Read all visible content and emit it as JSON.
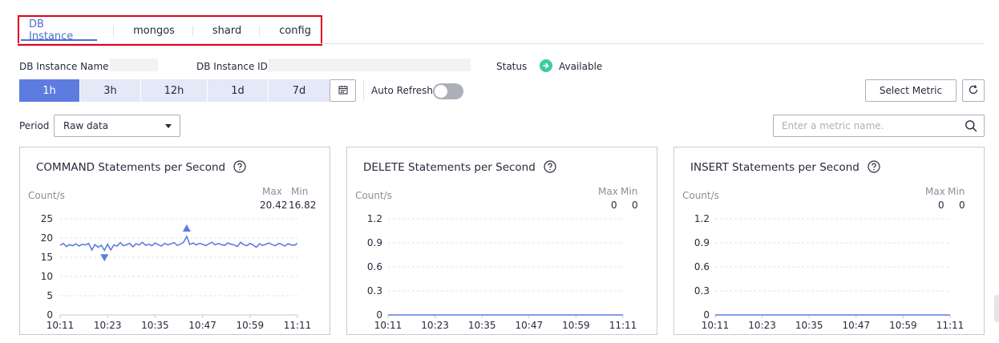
{
  "tabs": [
    {
      "label": "DB Instance",
      "active": true
    },
    {
      "label": "mongos",
      "active": false
    },
    {
      "label": "shard",
      "active": false
    },
    {
      "label": "config",
      "active": false
    }
  ],
  "info": {
    "name_label": "DB Instance Name",
    "id_label": "DB Instance ID",
    "status_label": "Status",
    "status_value": "Available",
    "status_color": "#3dcca6"
  },
  "ranges": [
    {
      "label": "1h",
      "active": true
    },
    {
      "label": "3h",
      "active": false
    },
    {
      "label": "12h",
      "active": false
    },
    {
      "label": "1d",
      "active": false
    },
    {
      "label": "7d",
      "active": false
    }
  ],
  "auto_refresh": {
    "label": "Auto Refresh",
    "enabled": false
  },
  "select_metric_label": "Select Metric",
  "period": {
    "label": "Period",
    "value": "Raw data"
  },
  "search": {
    "placeholder": "Enter a metric name."
  },
  "colors": {
    "accent": "#5e7ce0",
    "line": "#5e7ce0"
  },
  "chart_data": [
    {
      "type": "line",
      "title": "COMMAND Statements per Second",
      "ylabel": "Count/s",
      "max_label": "Max",
      "min_label": "Min",
      "max": "20.42",
      "min": "16.82",
      "yticks": [
        "25",
        "20",
        "15",
        "10",
        "5",
        "0"
      ],
      "ylim": [
        0,
        25
      ],
      "xticks": [
        "10:11",
        "10:23",
        "10:35",
        "10:47",
        "10:59",
        "11:11"
      ],
      "series": [
        {
          "values": [
            18.1,
            18.6,
            17.8,
            18.3,
            18.0,
            18.5,
            17.9,
            18.4,
            18.2,
            18.6,
            16.9,
            18.3,
            17.6,
            18.1,
            16.82,
            18.4,
            16.9,
            18.2,
            17.9,
            18.8,
            18.0,
            18.3,
            18.6,
            17.7,
            18.5,
            18.2,
            18.9,
            18.1,
            18.4,
            18.0,
            18.7,
            18.3,
            17.9,
            18.6,
            18.2,
            18.5,
            18.8,
            18.1,
            18.4,
            18.9,
            20.42,
            18.3,
            18.7,
            18.2,
            18.6,
            18.4,
            18.0,
            18.5,
            18.9,
            18.2,
            18.6,
            18.3,
            18.1,
            18.7,
            18.4,
            18.2,
            17.8,
            18.9,
            18.3,
            18.0,
            18.6,
            18.2,
            17.6,
            18.5,
            18.1,
            18.4,
            18.7,
            18.3,
            18.0,
            18.6,
            18.4,
            17.9,
            18.5,
            18.2,
            18.1,
            18.6
          ]
        }
      ]
    },
    {
      "type": "line",
      "title": "DELETE Statements per Second",
      "ylabel": "Count/s",
      "max_label": "Max",
      "min_label": "Min",
      "max": "0",
      "min": "0",
      "yticks": [
        "1.2",
        "0.9",
        "0.6",
        "0.3",
        "0"
      ],
      "ylim": [
        0,
        1.2
      ],
      "xticks": [
        "10:11",
        "10:23",
        "10:35",
        "10:47",
        "10:59",
        "11:11"
      ],
      "series": [
        {
          "values": [
            0,
            0
          ]
        }
      ]
    },
    {
      "type": "line",
      "title": "INSERT Statements per Second",
      "ylabel": "Count/s",
      "max_label": "Max",
      "min_label": "Min",
      "max": "0",
      "min": "0",
      "yticks": [
        "1.2",
        "0.9",
        "0.6",
        "0.3",
        "0"
      ],
      "ylim": [
        0,
        1.2
      ],
      "xticks": [
        "10:11",
        "10:23",
        "10:35",
        "10:47",
        "10:59",
        "11:11"
      ],
      "series": [
        {
          "values": [
            0,
            0
          ]
        }
      ]
    }
  ]
}
